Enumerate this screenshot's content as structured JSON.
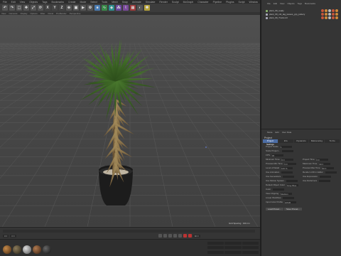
{
  "menubar": {
    "items": [
      "File",
      "Edit",
      "View",
      "Objects",
      "Tags",
      "Bookmarks",
      "Create",
      "Mode",
      "Select",
      "Tools",
      "Mesh",
      "Snap",
      "Animate",
      "Simulate",
      "Render",
      "Sculpt",
      "MoGraph",
      "Character",
      "Pipeline",
      "Plugins",
      "Script",
      "Window",
      "Help"
    ]
  },
  "toolbar": {
    "axis_x": "X",
    "axis_y": "Y",
    "axis_z": "Z"
  },
  "viewport": {
    "menu": [
      "View",
      "Cameras",
      "Display",
      "Options",
      "Filter",
      "Panel",
      "ProRender"
    ],
    "label": "Perspective",
    "grid_spacing": "Grid Spacing : 100 cm"
  },
  "timeline": {
    "frame_start": "0 F",
    "frame_current": "0 F",
    "frame_end": "90 F"
  },
  "object_manager": {
    "menu": [
      "File",
      "Edit",
      "View",
      "Objects",
      "Tags",
      "Bookmarks"
    ],
    "objects": [
      {
        "name": "plant_09_ready",
        "color": "#8ab36b"
      },
      {
        "name": "plant_09_mtl_tag_leaves_grp_pottery",
        "color": "#aab"
      },
      {
        "name": "plant_09_Trunk.mtl",
        "color": "#aab"
      }
    ]
  },
  "attribute_manager": {
    "menu": [
      "Mode",
      "Edit",
      "User Data"
    ],
    "title": "Project",
    "tabs": [
      "Project Settings",
      "Info",
      "Dynamics",
      "Referencing",
      "To Do"
    ],
    "active_tab": "Project Settings",
    "rows": [
      {
        "label": "Project Scale",
        "value": "1"
      },
      {
        "label": "Scale Project...",
        "value": ""
      },
      {
        "label": "FPS",
        "value": "30"
      },
      {
        "label": "Minimum Time",
        "value": "0 F"
      },
      {
        "label": "Preview Min Time",
        "value": "0 F"
      },
      {
        "label": "Level of Detail",
        "value": "100 %"
      },
      {
        "label": "Use Animation",
        "value": ""
      },
      {
        "label": "Use Generators",
        "value": ""
      },
      {
        "label": "Use Motion System",
        "value": ""
      },
      {
        "label": "Default Object Color",
        "value": "Gray Blue"
      },
      {
        "label": "Color",
        "value": ""
      },
      {
        "label": "View Clipping",
        "value": "Medium"
      },
      {
        "label": "Linear Workflow",
        "value": ""
      },
      {
        "label": "Input Color Profile",
        "value": "sRGB"
      }
    ],
    "rows_right": [
      {
        "label": "Project Time",
        "value": "0 F"
      },
      {
        "label": "Maximum Time",
        "value": "90 F"
      },
      {
        "label": "Preview Max Time",
        "value": "90 F"
      },
      {
        "label": "Render LOD in Editor",
        "value": ""
      },
      {
        "label": "Use Expression",
        "value": ""
      },
      {
        "label": "Use Deformers",
        "value": ""
      }
    ],
    "buttons": [
      "Load Preset...",
      "Save Preset..."
    ]
  },
  "colors": {
    "viewport_bg": "#4a4a4a",
    "accent": "#4c6da5",
    "pot": "#1f1f1f"
  }
}
